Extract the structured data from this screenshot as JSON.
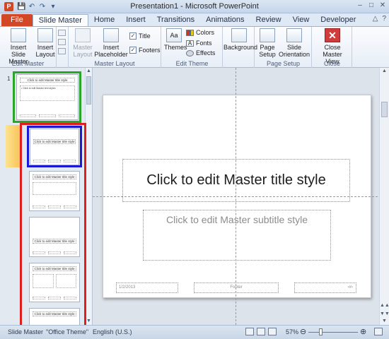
{
  "window": {
    "title": "Presentation1  -  Microsoft PowerPoint",
    "minimize": "–",
    "maximize": "□",
    "close": "✕"
  },
  "qat": {
    "save": "💾",
    "undo": "↶",
    "redo": "↷",
    "customize": "▾"
  },
  "tabs": [
    "File",
    "Slide Master",
    "Home",
    "Insert",
    "Transitions",
    "Animations",
    "Review",
    "View",
    "Developer"
  ],
  "ribbon_right": {
    "minimize_ribbon": "△",
    "help": "?"
  },
  "ribbon": {
    "edit_master": {
      "label": "Edit Master",
      "insert_slide_master": "Insert Slide Master",
      "insert_layout": "Insert Layout"
    },
    "master_layout": {
      "label": "Master Layout",
      "master_layout_btn": "Master Layout",
      "insert_placeholder": "Insert Placeholder",
      "title_chk": "Title",
      "footers_chk": "Footers"
    },
    "edit_theme": {
      "label": "Edit Theme",
      "themes": "Themes",
      "colors": "Colors",
      "fonts": "Fonts",
      "effects": "Effects"
    },
    "background": {
      "background": "Background"
    },
    "page_setup": {
      "label": "Page Setup",
      "page_setup": "Page Setup",
      "slide_orientation": "Slide Orientation"
    },
    "close": {
      "label": "Close",
      "close_master_view": "Close Master View"
    }
  },
  "thumbnails": {
    "master_number": "1",
    "master_title": "Click to edit Master title style",
    "master_body": "• Click to edit Master text styles",
    "layout1_title": "Click to edit Master title style",
    "layout2_title": "Click to edit Master title style",
    "layout3_title": "Click to edit Master title style",
    "layout4_title": "Click to edit Master title style",
    "layout5_title": "Click to edit Master title style"
  },
  "slide": {
    "title": "Click to edit Master title style",
    "subtitle": "Click to edit Master subtitle style",
    "date": "1/2/2013",
    "footer": "Footer",
    "number": "‹#›"
  },
  "status": {
    "view": "Slide Master",
    "theme": "\"Office Theme\"",
    "language": "English (U.S.)",
    "zoom": "57%",
    "zoom_out": "⊖",
    "zoom_in": "⊕",
    "zoom_level": 0.57
  },
  "highlight_colors": {
    "green": "#2aa52a",
    "blue": "#1a1ad6",
    "red": "#e01e1e"
  }
}
